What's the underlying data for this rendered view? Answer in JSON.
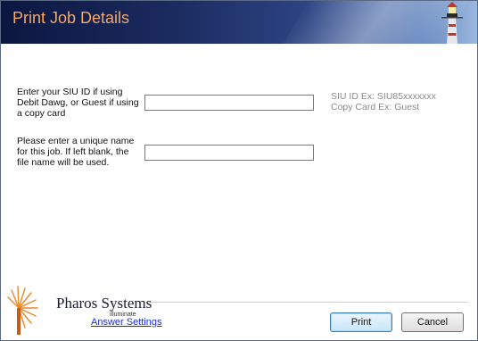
{
  "window": {
    "title": "Print Job Details"
  },
  "form": {
    "siu_label": "Enter your SIU ID if using Debit Dawg, or Guest if using a copy card",
    "siu_value": "",
    "jobname_label": "Please enter a unique name for this job. If left blank, the file name will be used.",
    "jobname_value": ""
  },
  "hints": {
    "siu_example": "SIU ID Ex: SIU85xxxxxxx",
    "copycard_example": "Copy Card Ex: Guest"
  },
  "footer": {
    "brand": "Pharos Systems",
    "brand_sub": "illuminate",
    "answer_settings_link": "Answer Settings",
    "print_button": "Print",
    "cancel_button": "Cancel"
  },
  "colors": {
    "title_text": "#f3a868",
    "banner_dark": "#0c1740",
    "banner_light": "#9bb8de",
    "link": "#1a2dd6"
  }
}
